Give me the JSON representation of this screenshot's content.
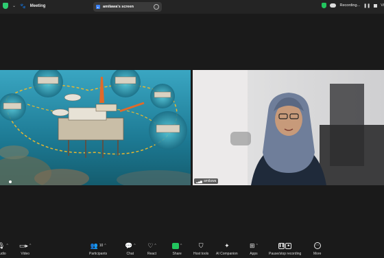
{
  "topbar": {
    "meeting_label": "Meeting",
    "share_pill": "amilawa's screen",
    "recording_label": "Recording...",
    "view_label": "Vi"
  },
  "participant": {
    "name": "amilawa"
  },
  "toolbar": {
    "audio_label": "udio",
    "video_label": "Video",
    "participants_label": "Participants",
    "participants_count": "10",
    "chat_label": "Chat",
    "react_label": "React",
    "share_label": "Share",
    "hosttools_label": "Host tools",
    "ai_label": "AI Companion",
    "apps_label": "Apps",
    "pause_label": "Pause/stop recording",
    "more_label": "More"
  },
  "colors": {
    "accent_green": "#22c55e",
    "share_blue": "#3b82f6"
  }
}
